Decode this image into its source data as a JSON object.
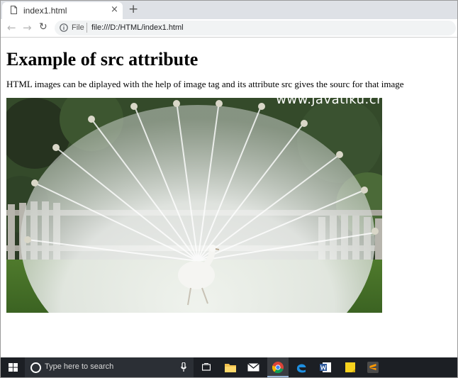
{
  "browser": {
    "tab_title": "index1.html",
    "tab_close": "×",
    "new_tab": "+",
    "back": "←",
    "forward": "→",
    "reload": "↻",
    "scheme_label": "File",
    "url": "file:///D:/HTML/index1.html"
  },
  "page": {
    "heading": "Example of src attribute",
    "paragraph": "HTML images can be diplayed with the help of image tag and its attribute src gives the sourc for that image",
    "image": {
      "watermark": "www.javatiku.cr"
    }
  },
  "taskbar": {
    "search_placeholder": "Type here to search",
    "apps": [
      "file-explorer",
      "mail",
      "chrome",
      "edge",
      "word",
      "sticky-notes",
      "sublime-text"
    ]
  },
  "colors": {
    "tabstrip": "#dee1e6",
    "taskbar": "#1c1f24",
    "omnibox": "#f1f3f4"
  }
}
